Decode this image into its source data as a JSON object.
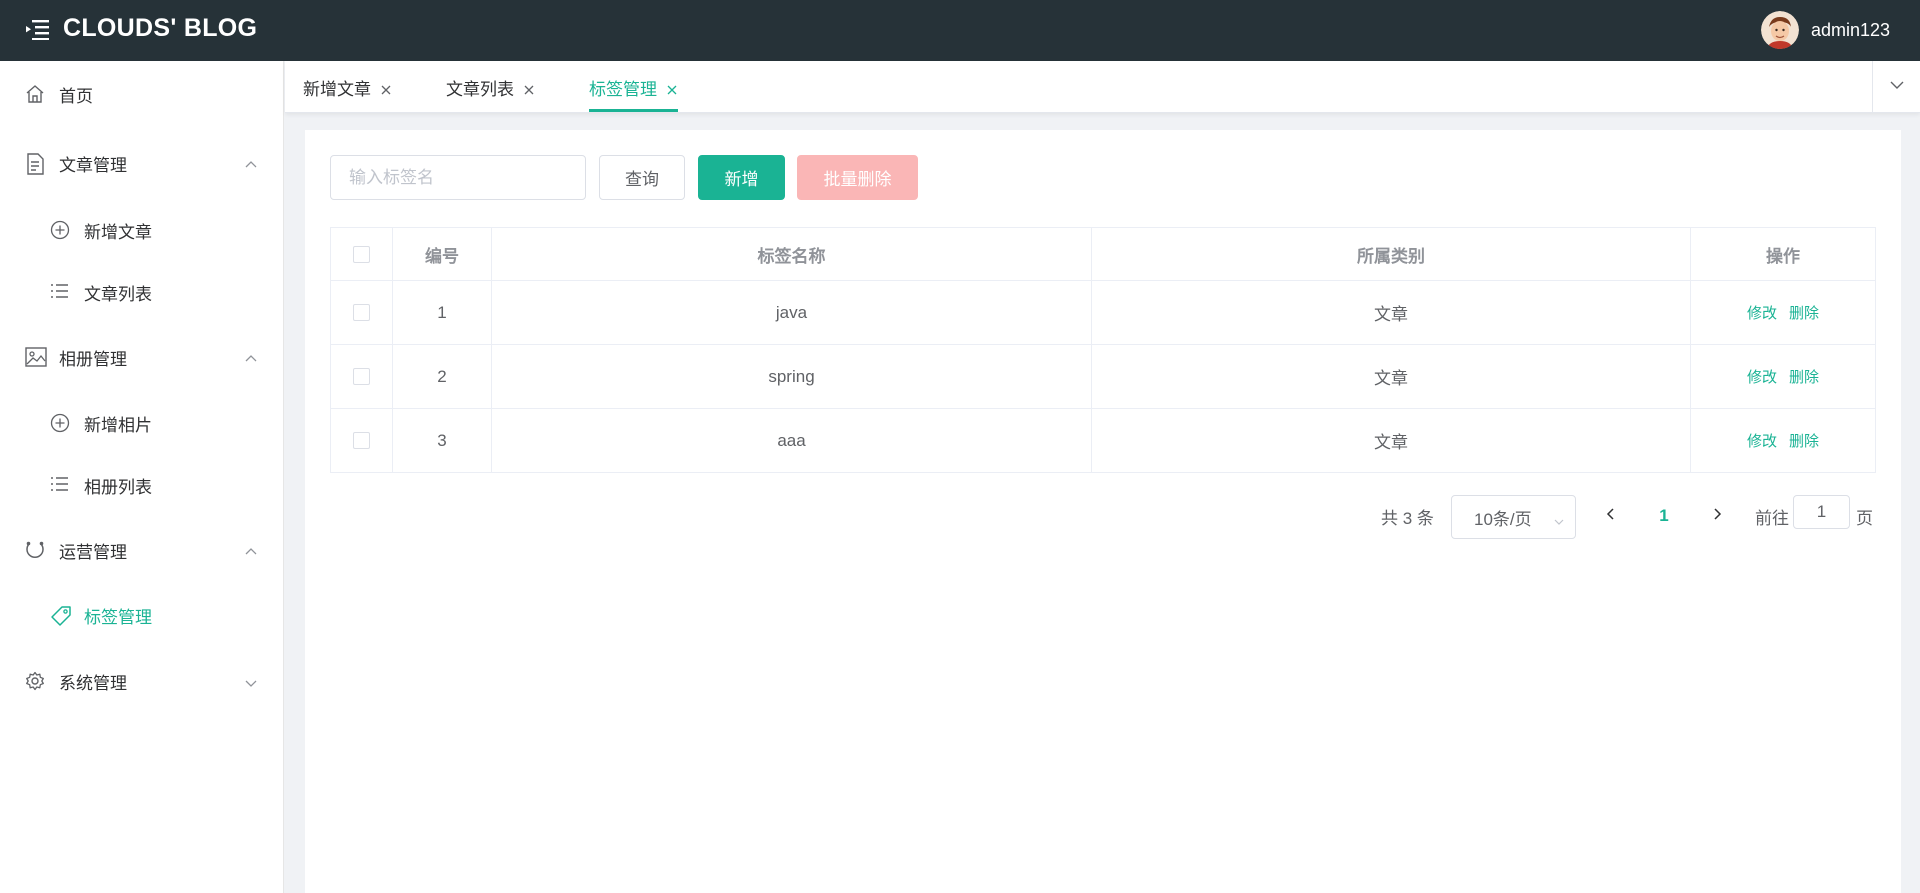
{
  "header": {
    "brand": "CLOUDS' BLOG",
    "username": "admin123"
  },
  "sidebar": {
    "items": [
      {
        "label": "首页",
        "icon": "home-icon"
      },
      {
        "label": "文章管理",
        "icon": "document-icon",
        "expanded": true
      },
      {
        "label": "新增文章",
        "icon": "plus-circle-icon"
      },
      {
        "label": "文章列表",
        "icon": "list-icon"
      },
      {
        "label": "相册管理",
        "icon": "picture-icon",
        "expanded": true
      },
      {
        "label": "新增相片",
        "icon": "plus-circle-icon"
      },
      {
        "label": "相册列表",
        "icon": "list-icon"
      },
      {
        "label": "运营管理",
        "icon": "operation-icon",
        "expanded": true
      },
      {
        "label": "标签管理",
        "icon": "tag-icon",
        "active": true
      },
      {
        "label": "系统管理",
        "icon": "gear-icon",
        "expanded": false
      }
    ]
  },
  "tabs": [
    {
      "label": "新增文章"
    },
    {
      "label": "文章列表"
    },
    {
      "label": "标签管理",
      "active": true
    }
  ],
  "toolbar": {
    "search_placeholder": "输入标签名",
    "query_label": "查询",
    "add_label": "新增",
    "batch_delete_label": "批量删除"
  },
  "table": {
    "headers": [
      "编号",
      "标签名称",
      "所属类别",
      "操作"
    ],
    "rows": [
      {
        "id": "1",
        "name": "java",
        "category": "文章"
      },
      {
        "id": "2",
        "name": "spring",
        "category": "文章"
      },
      {
        "id": "3",
        "name": "aaa",
        "category": "文章"
      }
    ],
    "edit_label": "修改",
    "delete_label": "删除"
  },
  "pagination": {
    "total": "共 3 条",
    "page_size": "10条/页",
    "current_page": "1",
    "goto_label": "前往",
    "goto_value": "1",
    "page_suffix": "页"
  },
  "colors": {
    "header_bg": "#263238",
    "accent": "#1ab394",
    "danger_disabled": "#fab6b6"
  }
}
